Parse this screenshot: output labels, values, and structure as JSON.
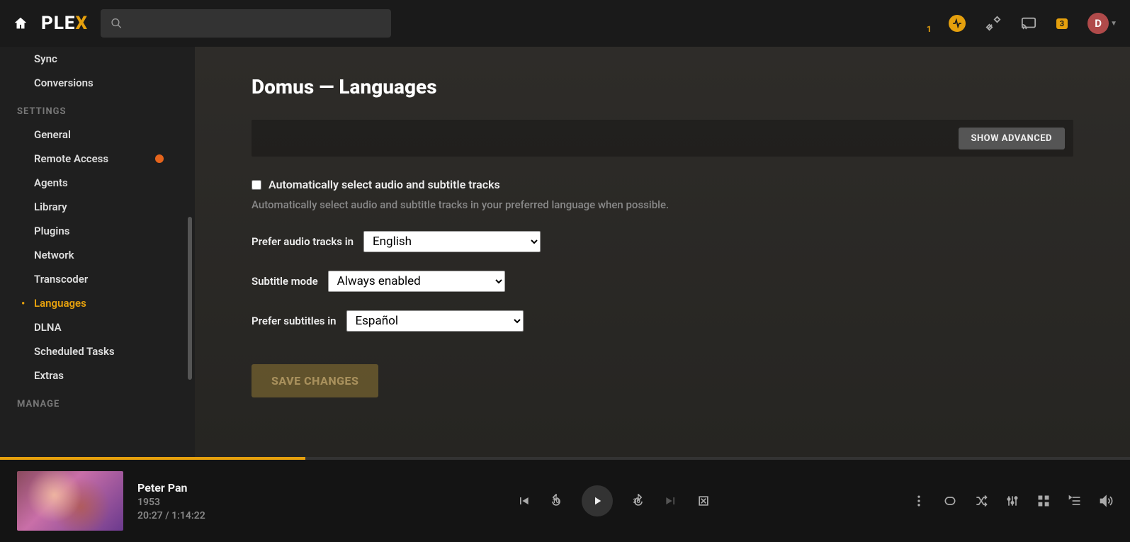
{
  "header": {
    "logo_main": "PLE",
    "logo_accent": "X",
    "activity_count": "1",
    "notif_count": "3",
    "avatar_initial": "D"
  },
  "sidebar": {
    "status_items": [
      {
        "label": "Sync"
      },
      {
        "label": "Conversions"
      }
    ],
    "settings_header": "SETTINGS",
    "settings_items": [
      {
        "label": "General",
        "warn": false,
        "active": false
      },
      {
        "label": "Remote Access",
        "warn": true,
        "active": false
      },
      {
        "label": "Agents",
        "warn": false,
        "active": false
      },
      {
        "label": "Library",
        "warn": false,
        "active": false
      },
      {
        "label": "Plugins",
        "warn": false,
        "active": false
      },
      {
        "label": "Network",
        "warn": false,
        "active": false
      },
      {
        "label": "Transcoder",
        "warn": false,
        "active": false
      },
      {
        "label": "Languages",
        "warn": false,
        "active": true
      },
      {
        "label": "DLNA",
        "warn": false,
        "active": false
      },
      {
        "label": "Scheduled Tasks",
        "warn": false,
        "active": false
      },
      {
        "label": "Extras",
        "warn": false,
        "active": false
      }
    ],
    "manage_header": "MANAGE"
  },
  "main": {
    "title": "Domus — Languages",
    "show_advanced": "SHOW ADVANCED",
    "auto_checkbox_label": "Automatically select audio and subtitle tracks",
    "auto_help": "Automatically select audio and subtitle tracks in your preferred language when possible.",
    "audio_label": "Prefer audio tracks in",
    "audio_value": "English",
    "subtitle_mode_label": "Subtitle mode",
    "subtitle_mode_value": "Always enabled",
    "sub_lang_label": "Prefer subtitles in",
    "sub_lang_value": "Español",
    "save_label": "SAVE CHANGES"
  },
  "player": {
    "title": "Peter Pan",
    "year": "1953",
    "elapsed": "20:27",
    "total": "1:14:22",
    "back_seconds": "10",
    "fwd_seconds": "30",
    "progress_pct": 27
  }
}
